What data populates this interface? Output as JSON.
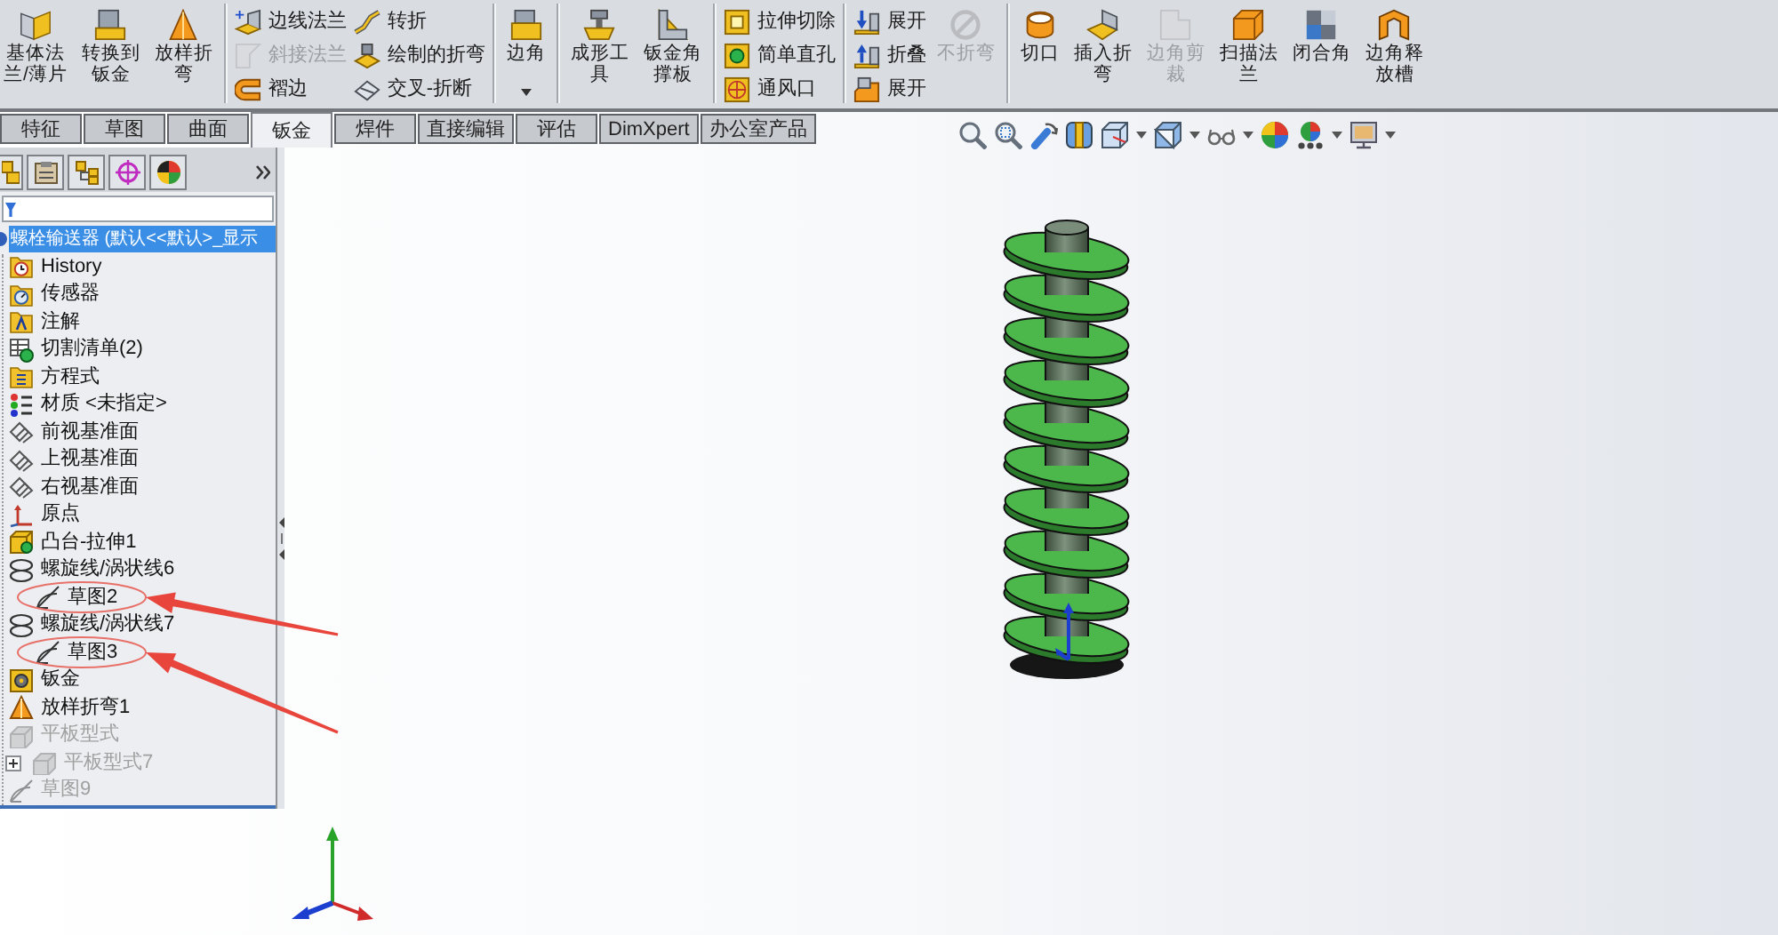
{
  "ribbon": {
    "groups": [
      {
        "items": [
          {
            "kind": "large",
            "lines": [
              "基体法",
              "兰/薄片"
            ],
            "disabled": false
          },
          {
            "kind": "large",
            "lines": [
              "转换到",
              "钣金"
            ],
            "disabled": false
          },
          {
            "kind": "large",
            "lines": [
              "放样折",
              "弯"
            ],
            "disabled": false
          }
        ]
      },
      {
        "items": [
          {
            "kind": "column",
            "buttons": [
              {
                "label": "边线法兰",
                "disabled": false
              },
              {
                "label": "斜接法兰",
                "disabled": true
              },
              {
                "label": "褶边",
                "disabled": false
              }
            ]
          },
          {
            "kind": "column",
            "buttons": [
              {
                "label": "转折",
                "disabled": false
              },
              {
                "label": "绘制的折弯",
                "disabled": false
              },
              {
                "label": "交叉-折断",
                "disabled": false
              }
            ]
          }
        ]
      },
      {
        "items": [
          {
            "kind": "large",
            "lines": [
              "边角"
            ],
            "disabled": false,
            "dropdown": true
          }
        ]
      },
      {
        "items": [
          {
            "kind": "large",
            "lines": [
              "成形工",
              "具"
            ],
            "disabled": false
          },
          {
            "kind": "large",
            "lines": [
              "钣金角",
              "撑板"
            ],
            "disabled": false
          }
        ]
      },
      {
        "items": [
          {
            "kind": "column",
            "buttons": [
              {
                "label": "拉伸切除",
                "disabled": false
              },
              {
                "label": "简单直孔",
                "disabled": false
              },
              {
                "label": "通风口",
                "disabled": false
              }
            ]
          }
        ]
      },
      {
        "items": [
          {
            "kind": "column",
            "buttons": [
              {
                "label": "展开",
                "disabled": false
              },
              {
                "label": "折叠",
                "disabled": false
              },
              {
                "label": "展开",
                "disabled": false
              }
            ]
          },
          {
            "kind": "large",
            "lines": [
              "不折弯"
            ],
            "disabled": true
          }
        ]
      },
      {
        "items": [
          {
            "kind": "large",
            "lines": [
              "切口"
            ],
            "disabled": false
          },
          {
            "kind": "large",
            "lines": [
              "插入折",
              "弯"
            ],
            "disabled": false
          },
          {
            "kind": "large",
            "lines": [
              "边角剪",
              "裁"
            ],
            "disabled": true
          },
          {
            "kind": "large",
            "lines": [
              "扫描法",
              "兰"
            ],
            "disabled": false
          },
          {
            "kind": "large",
            "lines": [
              "闭合角"
            ],
            "disabled": false
          },
          {
            "kind": "large",
            "lines": [
              "边角释",
              "放槽"
            ],
            "disabled": false
          }
        ]
      }
    ]
  },
  "tabs": [
    {
      "label": "特征",
      "selected": false
    },
    {
      "label": "草图",
      "selected": false
    },
    {
      "label": "曲面",
      "selected": false
    },
    {
      "label": "钣金",
      "selected": true
    },
    {
      "label": "焊件",
      "selected": false
    },
    {
      "label": "直接编辑",
      "selected": false
    },
    {
      "label": "评估",
      "selected": false
    },
    {
      "label": "DimXpert",
      "selected": false
    },
    {
      "label": "办公室产品",
      "selected": false
    }
  ],
  "feature_tree": {
    "items": [
      {
        "label": "螺栓输送器 (默认<<默认>_显示",
        "kind": "part",
        "selected": true,
        "disabled": false,
        "children": [
          {
            "label": "History",
            "kind": "history",
            "selected": false,
            "disabled": false
          },
          {
            "label": "传感器",
            "kind": "sensors",
            "selected": false,
            "disabled": false
          },
          {
            "label": "注解",
            "kind": "annotations",
            "selected": false,
            "disabled": false
          },
          {
            "label": "切割清单(2)",
            "kind": "cutlist",
            "selected": false,
            "disabled": false
          },
          {
            "label": "方程式",
            "kind": "equations",
            "selected": false,
            "disabled": false
          },
          {
            "label": "材质 <未指定>",
            "kind": "material",
            "selected": false,
            "disabled": false
          },
          {
            "label": "前视基准面",
            "kind": "plane",
            "selected": false,
            "disabled": false
          },
          {
            "label": "上视基准面",
            "kind": "plane",
            "selected": false,
            "disabled": false
          },
          {
            "label": "右视基准面",
            "kind": "plane",
            "selected": false,
            "disabled": false
          },
          {
            "label": "原点",
            "kind": "origin",
            "selected": false,
            "disabled": false
          },
          {
            "label": "凸台-拉伸1",
            "kind": "extrude",
            "selected": false,
            "disabled": false
          },
          {
            "label": "螺旋线/涡状线6",
            "kind": "helix",
            "selected": false,
            "disabled": false,
            "children": [
              {
                "label": "草图2",
                "kind": "sketch",
                "selected": false,
                "disabled": false
              }
            ]
          },
          {
            "label": "螺旋线/涡状线7",
            "kind": "helix",
            "selected": false,
            "disabled": false,
            "children": [
              {
                "label": "草图3",
                "kind": "sketch",
                "selected": false,
                "disabled": false
              }
            ]
          },
          {
            "label": "钣金",
            "kind": "sheetmetal",
            "selected": false,
            "disabled": false
          },
          {
            "label": "放样折弯1",
            "kind": "loftbend",
            "selected": false,
            "disabled": false
          },
          {
            "label": "平板型式",
            "kind": "flatpattern",
            "selected": false,
            "disabled": true,
            "children": [
              {
                "label": "平板型式7",
                "kind": "flatpattern",
                "selected": false,
                "disabled": true,
                "collapsed": true
              }
            ]
          },
          {
            "label": "草图9",
            "kind": "sketch",
            "selected": false,
            "disabled": true
          }
        ]
      }
    ]
  }
}
